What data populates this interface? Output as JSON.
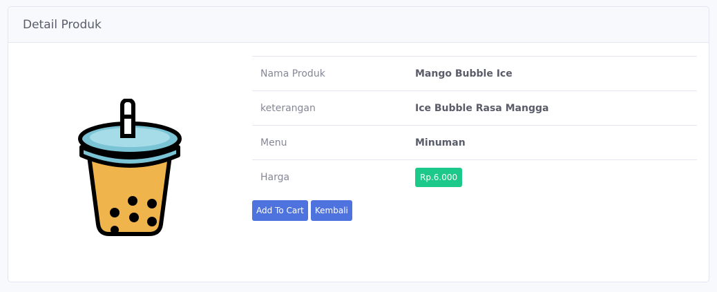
{
  "card": {
    "title": "Detail Produk"
  },
  "product_image": {
    "icon": "bubble-tea-icon",
    "cup_color": "#f0b44c",
    "lid_color": "#7bc4d6"
  },
  "details": [
    {
      "label": "Nama Produk",
      "value": "Mango Bubble Ice"
    },
    {
      "label": "keterangan",
      "value": "Ice Bubble Rasa Mangga"
    },
    {
      "label": "Menu",
      "value": "Minuman"
    },
    {
      "label": "Harga",
      "value": "Rp.6.000"
    }
  ],
  "actions": {
    "add_to_cart": "Add To Cart",
    "back": "Kembali"
  },
  "colors": {
    "primary": "#4e73df",
    "success": "#1cc88a"
  }
}
